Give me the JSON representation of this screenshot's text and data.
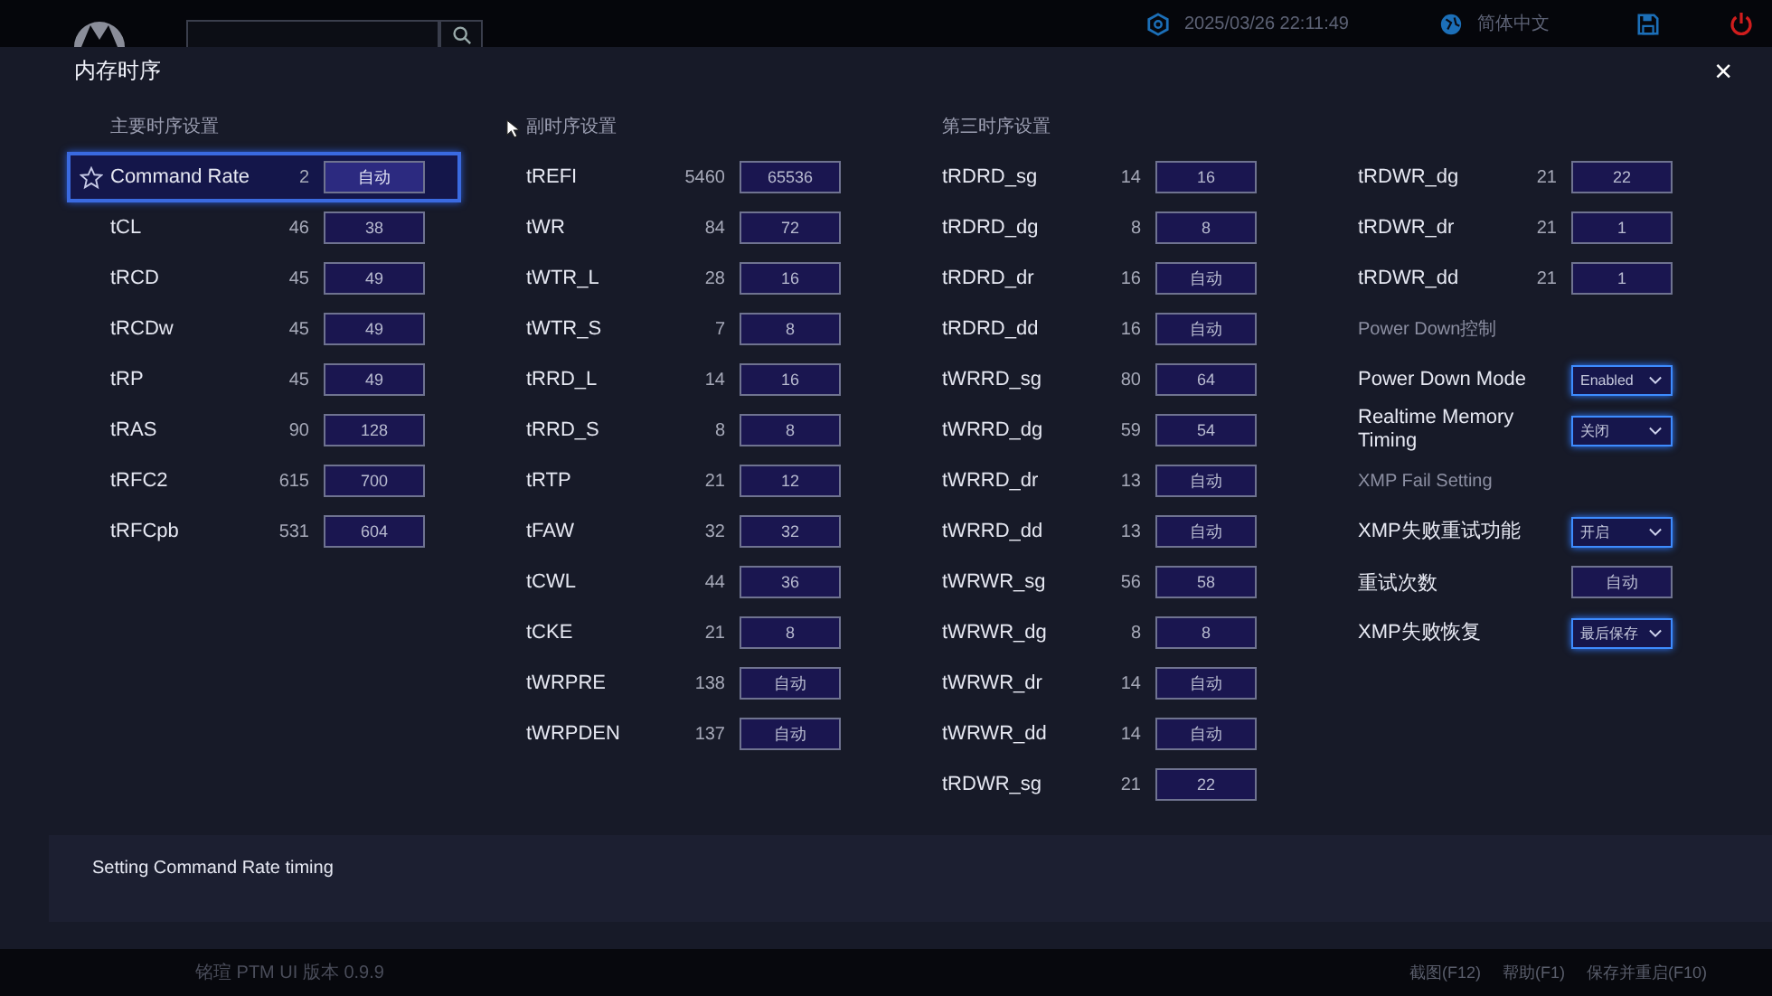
{
  "top_bar": {
    "datetime": "2025/03/26 22:11:49",
    "language": "简体中文"
  },
  "panel": {
    "title": "内存时序",
    "close": "×"
  },
  "columns": [
    {
      "heading": "主要时序设置",
      "items": [
        {
          "kind": "value",
          "label": "Command Rate",
          "current": "2",
          "value": "自动",
          "selected": true
        },
        {
          "kind": "value",
          "label": "tCL",
          "current": "46",
          "value": "38",
          "selected": false
        },
        {
          "kind": "value",
          "label": "tRCD",
          "current": "45",
          "value": "49",
          "selected": false
        },
        {
          "kind": "value",
          "label": "tRCDw",
          "current": "45",
          "value": "49",
          "selected": false
        },
        {
          "kind": "value",
          "label": "tRP",
          "current": "45",
          "value": "49",
          "selected": false
        },
        {
          "kind": "value",
          "label": "tRAS",
          "current": "90",
          "value": "128",
          "selected": false
        },
        {
          "kind": "value",
          "label": "tRFC2",
          "current": "615",
          "value": "700",
          "selected": false
        },
        {
          "kind": "value",
          "label": "tRFCpb",
          "current": "531",
          "value": "604",
          "selected": false
        }
      ]
    },
    {
      "heading": "副时序设置",
      "items": [
        {
          "kind": "value",
          "label": "tREFI",
          "current": "5460",
          "value": "65536",
          "selected": false
        },
        {
          "kind": "value",
          "label": "tWR",
          "current": "84",
          "value": "72",
          "selected": false
        },
        {
          "kind": "value",
          "label": "tWTR_L",
          "current": "28",
          "value": "16",
          "selected": false
        },
        {
          "kind": "value",
          "label": "tWTR_S",
          "current": "7",
          "value": "8",
          "selected": false
        },
        {
          "kind": "value",
          "label": "tRRD_L",
          "current": "14",
          "value": "16",
          "selected": false
        },
        {
          "kind": "value",
          "label": "tRRD_S",
          "current": "8",
          "value": "8",
          "selected": false
        },
        {
          "kind": "value",
          "label": "tRTP",
          "current": "21",
          "value": "12",
          "selected": false
        },
        {
          "kind": "value",
          "label": "tFAW",
          "current": "32",
          "value": "32",
          "selected": false
        },
        {
          "kind": "value",
          "label": "tCWL",
          "current": "44",
          "value": "36",
          "selected": false
        },
        {
          "kind": "value",
          "label": "tCKE",
          "current": "21",
          "value": "8",
          "selected": false
        },
        {
          "kind": "value",
          "label": "tWRPRE",
          "current": "138",
          "value": "自动",
          "selected": false
        },
        {
          "kind": "value",
          "label": "tWRPDEN",
          "current": "137",
          "value": "自动",
          "selected": false
        }
      ]
    },
    {
      "heading": "第三时序设置",
      "items": [
        {
          "kind": "value",
          "label": "tRDRD_sg",
          "current": "14",
          "value": "16",
          "selected": false
        },
        {
          "kind": "value",
          "label": "tRDRD_dg",
          "current": "8",
          "value": "8",
          "selected": false
        },
        {
          "kind": "value",
          "label": "tRDRD_dr",
          "current": "16",
          "value": "自动",
          "selected": false
        },
        {
          "kind": "value",
          "label": "tRDRD_dd",
          "current": "16",
          "value": "自动",
          "selected": false
        },
        {
          "kind": "value",
          "label": "tWRRD_sg",
          "current": "80",
          "value": "64",
          "selected": false
        },
        {
          "kind": "value",
          "label": "tWRRD_dg",
          "current": "59",
          "value": "54",
          "selected": false
        },
        {
          "kind": "value",
          "label": "tWRRD_dr",
          "current": "13",
          "value": "自动",
          "selected": false
        },
        {
          "kind": "value",
          "label": "tWRRD_dd",
          "current": "13",
          "value": "自动",
          "selected": false
        },
        {
          "kind": "value",
          "label": "tWRWR_sg",
          "current": "56",
          "value": "58",
          "selected": false
        },
        {
          "kind": "value",
          "label": "tWRWR_dg",
          "current": "8",
          "value": "8",
          "selected": false
        },
        {
          "kind": "value",
          "label": "tWRWR_dr",
          "current": "14",
          "value": "自动",
          "selected": false
        },
        {
          "kind": "value",
          "label": "tWRWR_dd",
          "current": "14",
          "value": "自动",
          "selected": false
        },
        {
          "kind": "value",
          "label": "tRDWR_sg",
          "current": "21",
          "value": "22",
          "selected": false
        }
      ]
    },
    {
      "items": [
        {
          "kind": "value",
          "label": "tRDWR_dg",
          "current": "21",
          "value": "22",
          "selected": false
        },
        {
          "kind": "value",
          "label": "tRDWR_dr",
          "current": "21",
          "value": "1",
          "selected": false
        },
        {
          "kind": "value",
          "label": "tRDWR_dd",
          "current": "21",
          "value": "1",
          "selected": false
        },
        {
          "kind": "section",
          "label": "Power Down控制"
        },
        {
          "kind": "select",
          "label": "Power Down Mode",
          "value": "Enabled",
          "selected": false
        },
        {
          "kind": "select",
          "label": "Realtime Memory Timing",
          "value": "关闭",
          "selected": false
        },
        {
          "kind": "section",
          "label": "XMP Fail Setting"
        },
        {
          "kind": "select",
          "label": "XMP失败重试功能",
          "value": "开启",
          "selected": false
        },
        {
          "kind": "value",
          "label": "重试次数",
          "value": "自动",
          "selected": false
        },
        {
          "kind": "select",
          "label": "XMP失败恢复",
          "value": "最后保存",
          "selected": false
        }
      ]
    }
  ],
  "help_text": "Setting Command Rate timing",
  "footer": {
    "version": "铭瑄 PTM UI 版本 0.9.9",
    "actions": [
      "截图(F12)",
      "帮助(F1)",
      "保存并重启(F10)"
    ]
  }
}
